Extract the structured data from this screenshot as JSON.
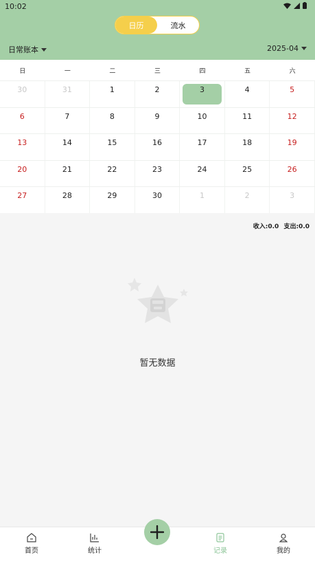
{
  "status_bar": {
    "time": "10:02"
  },
  "segmented": {
    "calendar_label": "日历",
    "flow_label": "流水"
  },
  "book_selector": {
    "label": "日常账本"
  },
  "month_selector": {
    "label": "2025-04"
  },
  "calendar": {
    "weekdays": [
      "日",
      "一",
      "二",
      "三",
      "四",
      "五",
      "六"
    ],
    "weeks": [
      [
        "30",
        "31",
        "1",
        "2",
        "3",
        "4",
        "5"
      ],
      [
        "6",
        "7",
        "8",
        "9",
        "10",
        "11",
        "12"
      ],
      [
        "13",
        "14",
        "15",
        "16",
        "17",
        "18",
        "19"
      ],
      [
        "20",
        "21",
        "22",
        "23",
        "24",
        "25",
        "26"
      ],
      [
        "27",
        "28",
        "29",
        "30",
        "1",
        "2",
        "3"
      ]
    ],
    "other_month_prefix": 2,
    "other_month_suffix": 3,
    "selected_day": "3",
    "colors": {
      "selected": "#a4cfa6",
      "weekend": "#c71f1f",
      "other_month": "#c8c8c8"
    }
  },
  "summary": {
    "income": "收入:0.0",
    "expense": "支出:0.0"
  },
  "empty_state": {
    "text": "暂无数据"
  },
  "tabbar": {
    "home": "首页",
    "stats": "统计",
    "records": "记录",
    "mine": "我的"
  },
  "theme": {
    "accent": "#a4cfa6",
    "segment": "#f5cf4b"
  }
}
